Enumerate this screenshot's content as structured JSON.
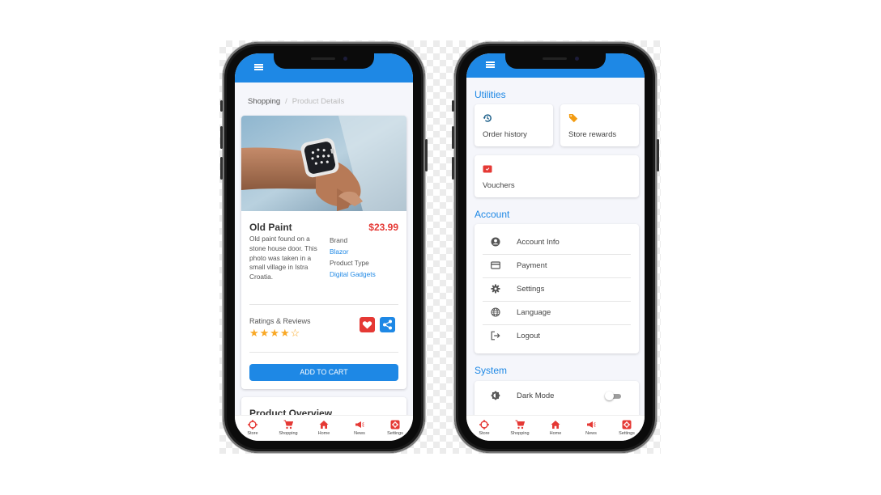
{
  "left": {
    "breadcrumb": {
      "parent": "Shopping",
      "separator": "/",
      "current": "Product Details"
    },
    "product": {
      "name": "Old Paint",
      "price": "$23.99",
      "description": "Old paint found on a stone house door. This photo was taken in a small village in Istra Croatia.",
      "brand_label": "Brand",
      "brand_value": "Blazor",
      "type_label": "Product Type",
      "type_value": "Digital Gadgets",
      "ratings_label": "Ratings & Reviews",
      "stars": "★★★★☆",
      "rating": 4,
      "rating_max": 5,
      "add_to_cart": "ADD TO CART"
    },
    "overview_title": "Product Overview",
    "nav": [
      "Store",
      "Shopping",
      "Home",
      "News",
      "Settings"
    ]
  },
  "right": {
    "utilities_title": "Utilities",
    "tiles": [
      "Order history",
      "Store rewards",
      "Vouchers"
    ],
    "account_title": "Account",
    "account_items": [
      "Account Info",
      "Payment",
      "Settings",
      "Language",
      "Logout"
    ],
    "system_title": "System",
    "system_items": [
      "Dark Mode"
    ],
    "dark_mode_on": false,
    "nav": [
      "Store",
      "Shopping",
      "Home",
      "News",
      "Settings"
    ],
    "active_nav": "Settings"
  },
  "colors": {
    "primary": "#1e88e5",
    "accent_red": "#e53935",
    "star": "#f9a825",
    "reward_orange": "#f39c12",
    "nav_icon": "#e53935"
  }
}
